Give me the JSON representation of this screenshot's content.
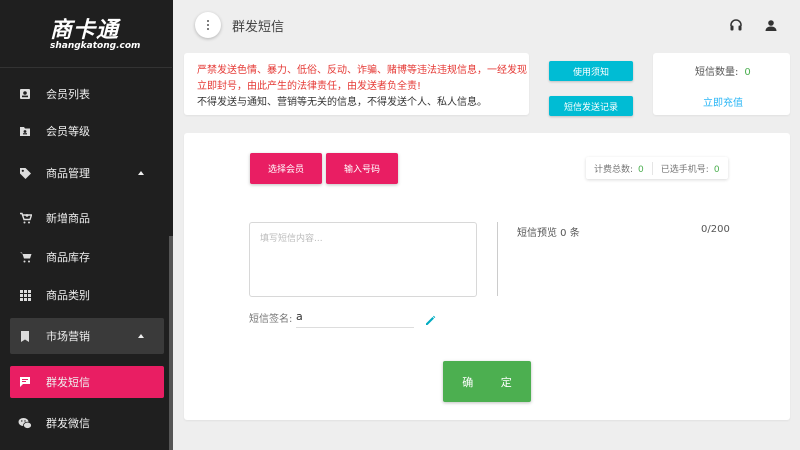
{
  "brand": {
    "name": "商卡通",
    "domain": "shangkatong.com"
  },
  "sidebar": {
    "items": [
      {
        "label": "会员列表",
        "icon": "member-list-icon"
      },
      {
        "label": "会员等级",
        "icon": "member-level-icon"
      },
      {
        "label": "商品管理",
        "icon": "tag-icon",
        "expandable": true
      },
      {
        "label": "新增商品",
        "icon": "add-cart-icon"
      },
      {
        "label": "商品库存",
        "icon": "cart-icon"
      },
      {
        "label": "商品类别",
        "icon": "grid-icon"
      },
      {
        "label": "市场营销",
        "icon": "bookmark-icon",
        "expandable": true
      },
      {
        "label": "群发短信",
        "icon": "sms-icon",
        "active": true
      },
      {
        "label": "群发微信",
        "icon": "wechat-icon"
      }
    ]
  },
  "header": {
    "title": "群发短信"
  },
  "notice": {
    "warning": "严禁发送色情、暴力、低俗、反动、诈骗、赌博等违法违规信息，一经发现立即封号，由此产生的法律责任，由发送者负全责!",
    "info": "不得发送与通知、营销等无关的信息，不得发送个人、私人信息。",
    "usage_button": "使用须知",
    "records_button": "短信发送记录"
  },
  "sms_balance": {
    "label": "短信数量:",
    "value": "0",
    "recharge": "立即充值"
  },
  "compose": {
    "select_member_button": "选择会员",
    "enter_number_button": "输入号码",
    "billing_total_label": "计费总数:",
    "billing_total_value": "0",
    "selected_phones_label": "已选手机号:",
    "selected_phones_value": "0",
    "content_placeholder": "填写短信内容...",
    "preview_label": "短信预览 0 条",
    "char_counter": "0/200",
    "signature_label": "短信签名:",
    "signature_value": "a",
    "confirm_button": "确 定"
  },
  "colors": {
    "primary_pink": "#e91e63",
    "cyan": "#00bcd4",
    "green": "#4caf50",
    "sidebar_bg": "#1f1f1f"
  }
}
